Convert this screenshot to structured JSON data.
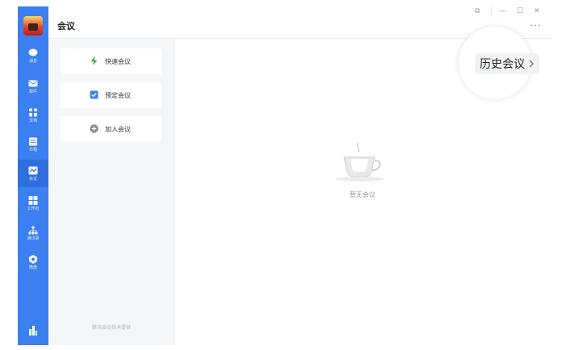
{
  "nav": {
    "items": [
      {
        "label": "消息",
        "icon": "chat-bubble-icon"
      },
      {
        "label": "邮件",
        "icon": "mail-icon"
      },
      {
        "label": "文档",
        "icon": "document-icon"
      },
      {
        "label": "日程",
        "icon": "calendar-icon"
      },
      {
        "label": "会议",
        "icon": "meeting-icon"
      },
      {
        "label": "工作台",
        "icon": "workbench-grid-icon"
      },
      {
        "label": "通讯录",
        "icon": "contacts-tree-icon"
      },
      {
        "label": "微盘",
        "icon": "disk-icon"
      }
    ],
    "active_index": 4
  },
  "header": {
    "title": "会议",
    "window_controls": [
      "⧉",
      "|",
      "—",
      "☐",
      "✕"
    ],
    "more": "···"
  },
  "actions": [
    {
      "label": "快速会议",
      "icon": "lightning-icon",
      "color": "#2bb54a"
    },
    {
      "label": "预定会议",
      "icon": "checkbox-icon",
      "color": "#3b7ff0"
    },
    {
      "label": "加入会议",
      "icon": "plus-circle-icon",
      "color": "#8c8c8c"
    }
  ],
  "footer_note": "腾讯会议技术提供",
  "history": {
    "label": "历史会议",
    "chevron": ">"
  },
  "empty_state": {
    "label": "暂无会议",
    "icon": "coffee-cup-icon"
  },
  "colors": {
    "rail": "#3b7ff0",
    "rail_active": "#2f6fe0",
    "background": "#f5f6f7"
  }
}
